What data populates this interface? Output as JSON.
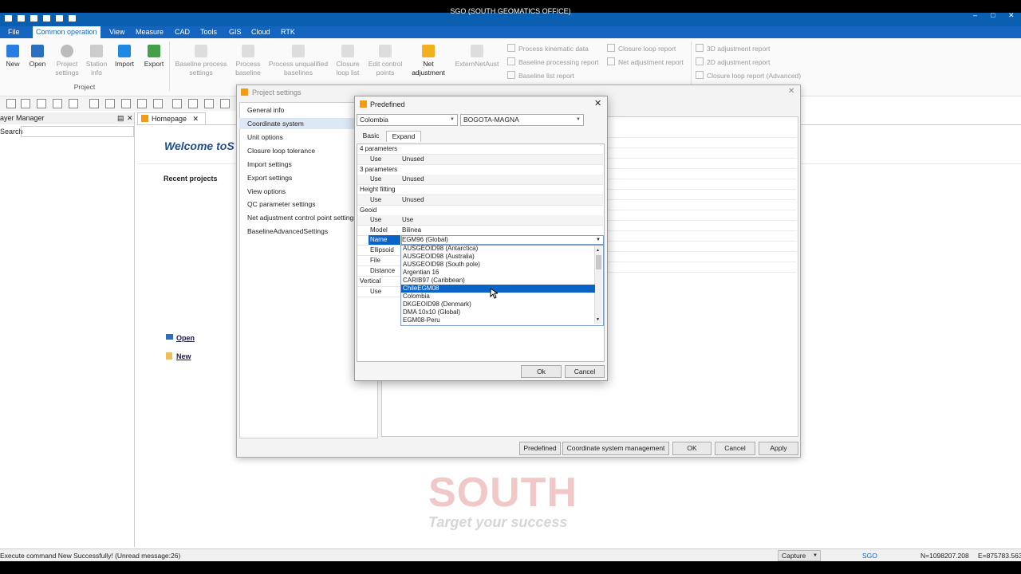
{
  "window": {
    "title": "SGO (SOUTH GEOMATICS OFFICE)"
  },
  "menu": [
    "File",
    "Common operation",
    "View",
    "Measure",
    "CAD",
    "Tools",
    "GIS",
    "Cloud",
    "RTK"
  ],
  "ribbon": {
    "buttons": [
      {
        "label": "New"
      },
      {
        "label": "Open"
      },
      {
        "label": "Project settings"
      },
      {
        "label": "Station info"
      },
      {
        "label": "Import"
      },
      {
        "label": "Export"
      },
      {
        "label": "Baseline process settings"
      },
      {
        "label": "Process baseline"
      },
      {
        "label": "Process unqualified baselines"
      },
      {
        "label": "Closure loop list"
      },
      {
        "label": "Edit control points"
      },
      {
        "label": "Net adjustment"
      },
      {
        "label": "ExternNetAust"
      }
    ],
    "group_label": "Project",
    "small_items": [
      "Process kinematic data",
      "Baseline processing report",
      "Baseline list report",
      "Closure loop report",
      "Net adjustment report",
      "3D adjustment report",
      "2D adjustment report",
      "Closure loop report (Advanced)"
    ]
  },
  "layer_manager": {
    "title": "ayer Manager",
    "search_label": "Search"
  },
  "homepage": {
    "tab": "Homepage",
    "welcome": "Welcome toS",
    "recent": "Recent projects",
    "open": "Open",
    "new": "New",
    "logo": "SOUTH",
    "tagline": "Target your success"
  },
  "project_settings": {
    "title": "Project settings",
    "nav": [
      "General info",
      "Coordinate system",
      "Unit options",
      "Closure loop tolerance",
      "Import settings",
      "Export settings",
      "View options",
      "QC parameter settings",
      "Net adjustment control point settings",
      "BaselineAdvancedSettings"
    ],
    "buttons": [
      "Predefined",
      "Coordinate system management",
      "OK",
      "Cancel",
      "Apply"
    ]
  },
  "predefined": {
    "title": "Predefined",
    "country": "Colombia",
    "system": "BOGOTA-MAGNA",
    "tabs": [
      "Basic",
      "Expand"
    ],
    "rows": [
      {
        "k": "4 parameters",
        "v": "",
        "hdr": true
      },
      {
        "k": "Use",
        "v": "Unused"
      },
      {
        "k": "3 parameters",
        "v": "",
        "hdr": true
      },
      {
        "k": "Use",
        "v": "Unused"
      },
      {
        "k": "Height fitting",
        "v": "",
        "hdr": true
      },
      {
        "k": "Use",
        "v": "Unused"
      },
      {
        "k": "Geoid",
        "v": "",
        "hdr": true
      },
      {
        "k": "Use",
        "v": "Use"
      },
      {
        "k": "Model",
        "v": "Bilinea"
      },
      {
        "k": "Name",
        "v": "EGM96 (Global)"
      },
      {
        "k": "Ellipsoid",
        "v": ""
      },
      {
        "k": "File",
        "v": ""
      },
      {
        "k": "Distance",
        "v": ""
      },
      {
        "k": "Vertical",
        "v": "",
        "hdr": true
      },
      {
        "k": "Use",
        "v": ""
      }
    ],
    "dropdown": [
      "AUSGEOID98 (Antarctica)",
      "AUSGEOID98 (Australia)",
      "AUSGEOID98 (South pole)",
      "Argentian 16",
      "CARIB97 (Caribbean)",
      "ChileEGM08",
      "Colombia",
      "DKGEOID98 (Denmark)",
      "DMA 10x10 (Global)",
      "EGM08-Peru"
    ],
    "selected": "ChileEGM08",
    "ok": "Ok",
    "cancel": "Cancel"
  },
  "status": {
    "message": "Execute command New Successfully! (Unread message:26)",
    "capture": "Capture",
    "app": "SGO",
    "north": "N=1098207.208",
    "east": "E=875783.563"
  }
}
